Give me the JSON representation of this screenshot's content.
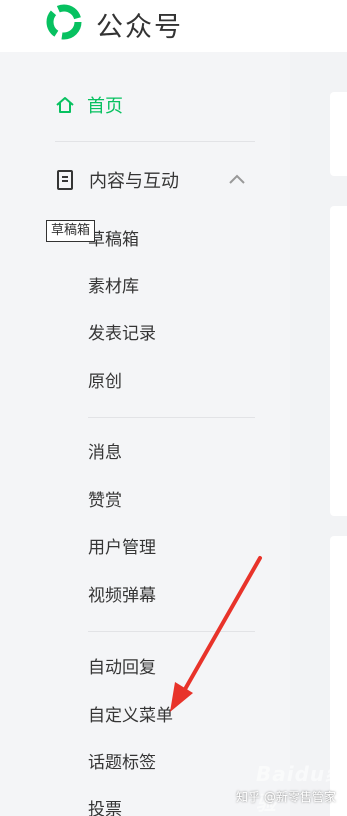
{
  "header": {
    "brand": "公众号"
  },
  "nav": {
    "home": {
      "label": "首页",
      "icon": "home-icon"
    },
    "content_section": {
      "label": "内容与互动",
      "icon": "document-icon",
      "expanded": true,
      "toggle_icon": "chevron-up-icon"
    },
    "content_items": [
      "草稿箱",
      "素材库",
      "发表记录",
      "原创"
    ],
    "interaction_items": [
      "消息",
      "赞赏",
      "用户管理",
      "视频弹幕"
    ],
    "reply_items": [
      "自动回复",
      "自定义菜单",
      "话题标签",
      "投票"
    ]
  },
  "tooltip": {
    "text": "草稿箱"
  },
  "watermark": {
    "text": "知乎 @新零售管家",
    "brand": "Baidu经验"
  },
  "colors": {
    "accent": "#07c160",
    "arrow": "#e8332a"
  }
}
